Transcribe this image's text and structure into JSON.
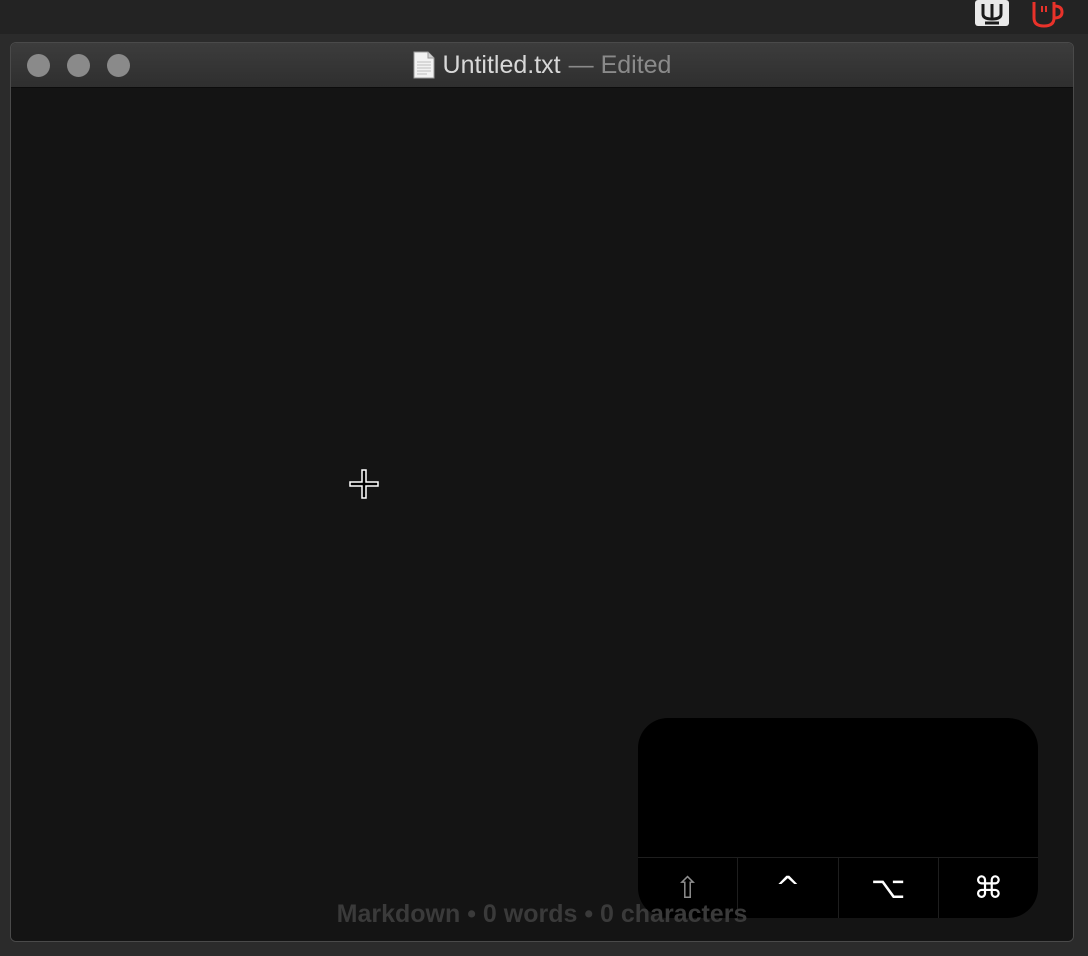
{
  "window": {
    "filename": "Untitled.txt",
    "edited_suffix": "— Edited"
  },
  "keys": {
    "shift": "⇧",
    "control": "^",
    "option": "⌥",
    "command": "⌘"
  },
  "status": {
    "text": "Markdown • 0 words • 0 characters"
  },
  "icons": {
    "menubar": [
      "app-menubar-icon",
      "coffee-cup-icon"
    ],
    "document": "document-icon",
    "cursor": "crosshair-cursor-icon"
  },
  "colors": {
    "editor_background": "#141414",
    "keys_panel": "#000000",
    "coffee_icon": "#e8322a"
  }
}
